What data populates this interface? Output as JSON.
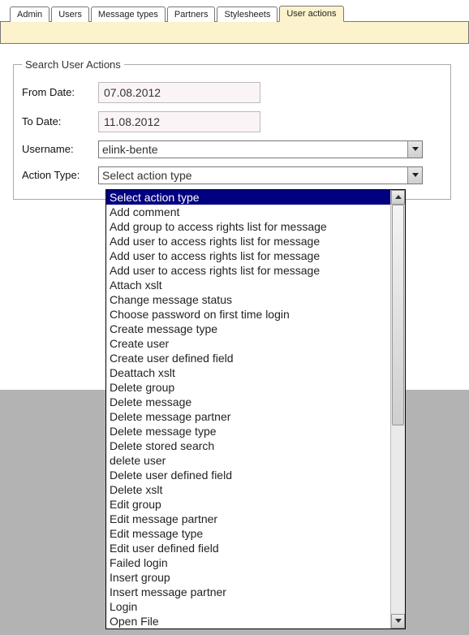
{
  "tabs": {
    "items": [
      {
        "label": "Admin"
      },
      {
        "label": "Users"
      },
      {
        "label": "Message types"
      },
      {
        "label": "Partners"
      },
      {
        "label": "Stylesheets"
      },
      {
        "label": "User actions"
      }
    ],
    "active_index": 5
  },
  "fieldset": {
    "legend": "Search User Actions",
    "from_label": "From Date:",
    "from_value": "07.08.2012",
    "to_label": "To Date:",
    "to_value": "11.08.2012",
    "username_label": "Username:",
    "username_value": "elink-bente",
    "action_label": "Action Type:",
    "action_selected": "Select action type"
  },
  "action_type_options": [
    "Select action type",
    "Add comment",
    "Add group to access rights list for message",
    "Add user to access rights list for message",
    "Add user to access rights list for message",
    "Add user to access rights list for message",
    "Attach xslt",
    "Change message status",
    "Choose password on first time login",
    "Create message type",
    "Create user",
    "Create user defined field",
    "Deattach xslt",
    "Delete group",
    "Delete message",
    "Delete message partner",
    "Delete message type",
    "Delete stored search",
    "delete user",
    "Delete user defined field",
    "Delete xslt",
    "Edit group",
    "Edit message partner",
    "Edit message type",
    "Edit user defined field",
    "Failed login",
    "Insert group",
    "Insert message partner",
    "Login",
    "Open File"
  ],
  "selected_option_index": 0
}
